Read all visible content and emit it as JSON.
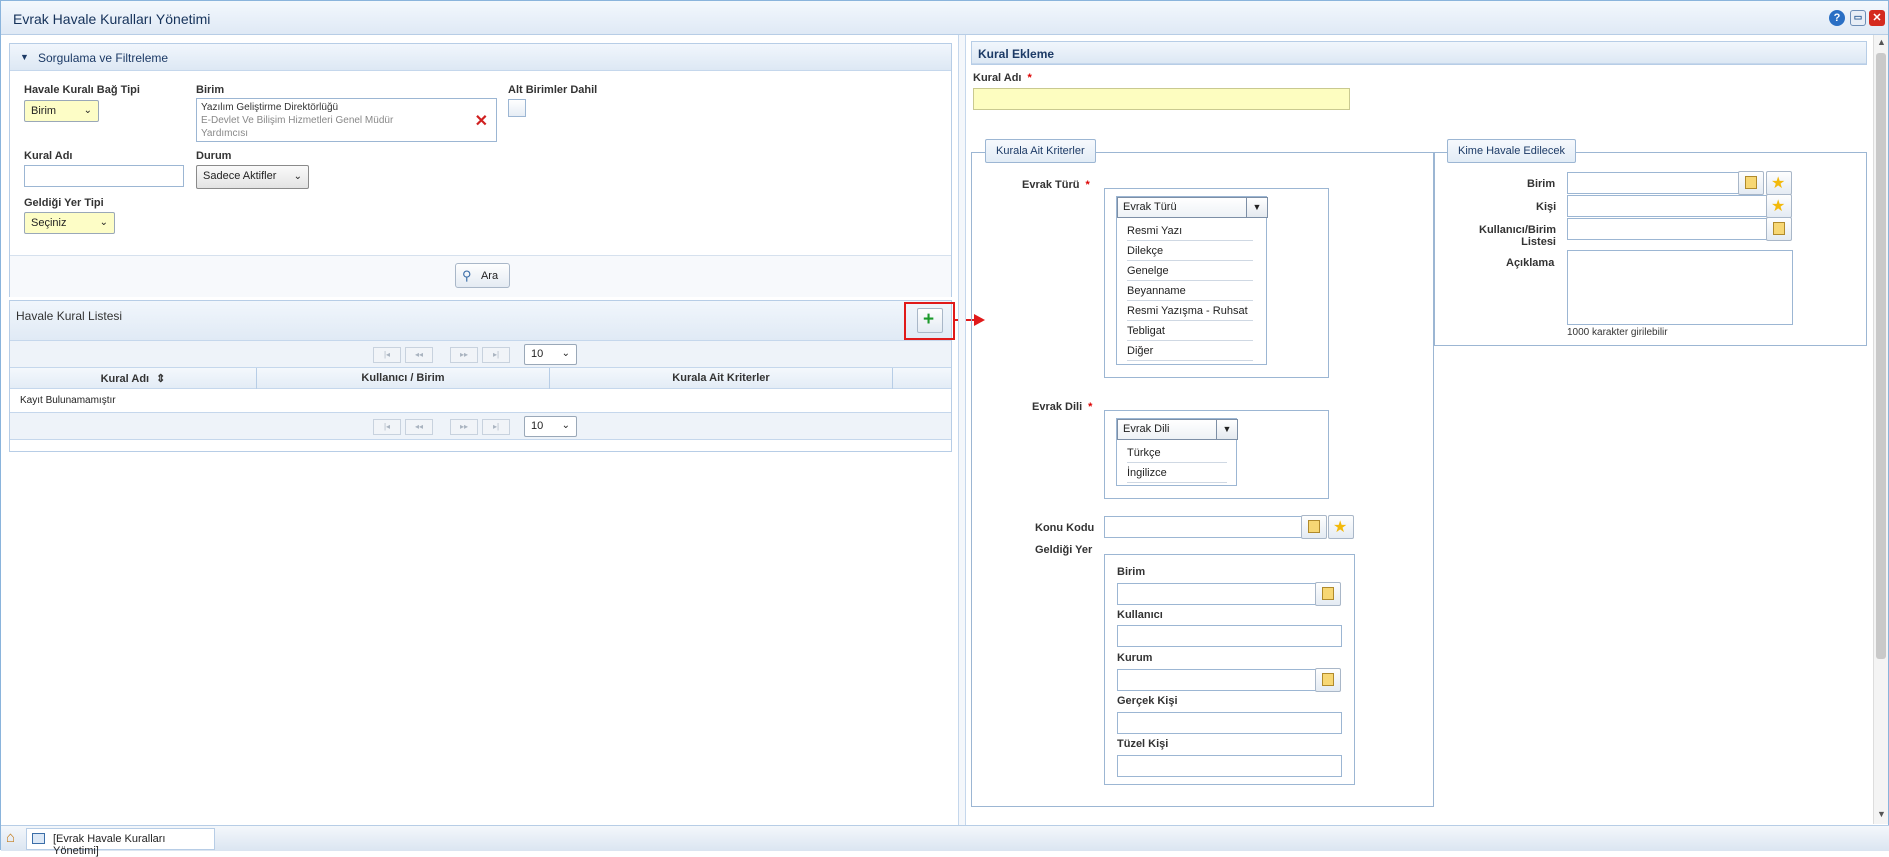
{
  "window": {
    "title": "Evrak Havale Kuralları Yönetimi"
  },
  "filter": {
    "header": "Sorgulama ve Filtreleme",
    "bag_tipi_label": "Havale Kuralı Bağ Tipi",
    "bag_tipi_value": "Birim",
    "birim_label": "Birim",
    "birim_line1": "Yazılım Geliştirme Direktörlüğü",
    "birim_line2": "E-Devlet Ve Bilişim Hizmetleri Genel Müdür",
    "birim_line3": "Yardımcısı",
    "alt_birimler_label": "Alt Birimler Dahil",
    "kural_adi_label": "Kural Adı",
    "kural_adi_value": "",
    "durum_label": "Durum",
    "durum_value": "Sadece Aktifler",
    "geldigi_yer_label": "Geldiği Yer Tipi",
    "geldigi_yer_value": "Seçiniz",
    "search_label": "Ara"
  },
  "list": {
    "header": "Havale Kural Listesi",
    "page_size": "10",
    "columns": [
      "Kural Adı",
      "Kullanıcı / Birim",
      "Kurala Ait Kriterler"
    ],
    "empty_text": "Kayıt Bulunamamıştır"
  },
  "form": {
    "header": "Kural Ekleme",
    "kural_adi_label": "Kural Adı",
    "required_mark": "*",
    "kriterler_legend": "Kurala Ait Kriterler",
    "evrak_turu_label": "Evrak Türü",
    "evrak_turu_header": "Evrak Türü",
    "evrak_turu_items": [
      "Resmi Yazı",
      "Dilekçe",
      "Genelge",
      "Beyanname",
      "Resmi Yazışma - Ruhsat",
      "Tebligat",
      "Diğer"
    ],
    "evrak_dili_label": "Evrak Dili",
    "evrak_dili_header": "Evrak Dili",
    "evrak_dili_items": [
      "Türkçe",
      "İngilizce"
    ],
    "konu_kodu_label": "Konu Kodu",
    "geldigi_yer_label": "Geldiği Yer",
    "gy_birim_label": "Birim",
    "gy_kullanici_label": "Kullanıcı",
    "gy_kurum_label": "Kurum",
    "gy_gercek_label": "Gerçek Kişi",
    "gy_tuzel_label": "Tüzel Kişi",
    "kime_legend": "Kime Havale Edilecek",
    "kime_birim_label": "Birim",
    "kime_kisi_label": "Kişi",
    "kime_liste_label1": "Kullanıcı/Birim",
    "kime_liste_label2": "Listesi",
    "aciklama_label": "Açıklama",
    "char_hint": "1000 karakter girilebilir"
  },
  "taskbar": {
    "tab_label": "[Evrak Havale Kuralları Yönetimi]"
  }
}
